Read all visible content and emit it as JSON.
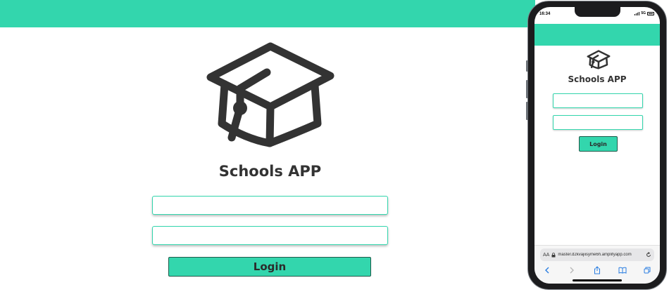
{
  "colors": {
    "accent": "#33d6ad",
    "text": "#333333",
    "button_border": "#1f5a4a"
  },
  "desktop": {
    "title": "Schools APP",
    "login_label": "Login",
    "logo_icon": "graduation-cap-icon"
  },
  "phone": {
    "status": {
      "time": "16:34",
      "network": "5G"
    },
    "title": "Schools APP",
    "login_label": "Login",
    "logo_icon": "graduation-cap-icon",
    "browser": {
      "text_size_label": "AA",
      "url": "master.d2kvajiisyme6h.amplifyapp.com",
      "toolbar_icons": [
        "back-icon",
        "forward-icon",
        "share-icon",
        "bookmarks-icon",
        "tabs-icon"
      ]
    }
  }
}
